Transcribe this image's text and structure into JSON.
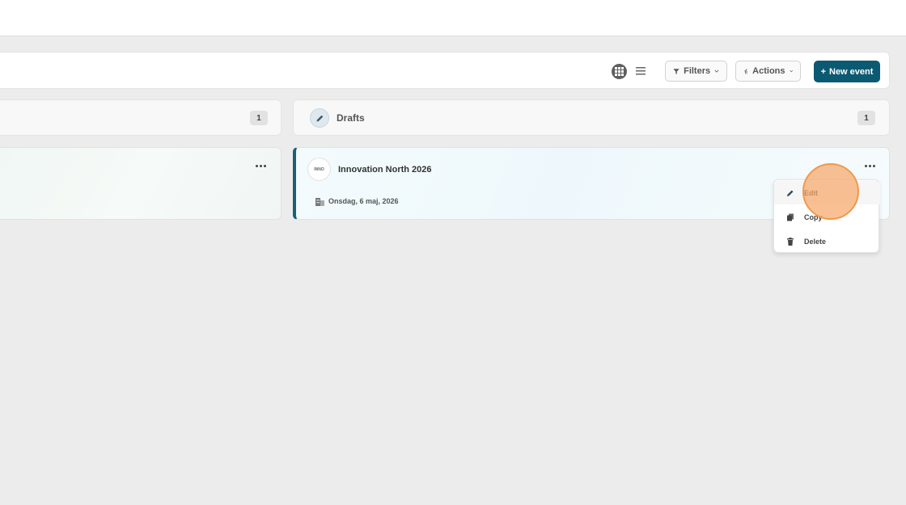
{
  "toolbar": {
    "filters_label": "Filters",
    "actions_label": "Actions",
    "new_event_label": "New event",
    "new_event_plus": "+"
  },
  "columns": [
    {
      "count": "1"
    },
    {
      "title": "Drafts",
      "count": "1"
    }
  ],
  "event_card": {
    "logo_text": "INNO",
    "title": "Innovation North 2026",
    "date": "Onsdag, 6 maj, 2026"
  },
  "context_menu": {
    "items": [
      {
        "label": "Edit",
        "icon": "pencil-icon"
      },
      {
        "label": "Copy",
        "icon": "copy-icon"
      },
      {
        "label": "Delete",
        "icon": "trash-icon"
      }
    ]
  },
  "colors": {
    "primary": "#0c5a72",
    "card_accent": "#1b5f78",
    "cursor_highlight": "#f6a86a"
  }
}
